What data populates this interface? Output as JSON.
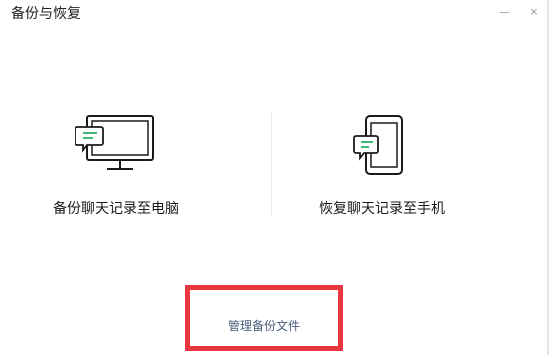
{
  "window": {
    "title": "备份与恢复",
    "minimize_icon": "minimize-icon",
    "close_label": "×"
  },
  "options": {
    "backup": {
      "label": "备份聊天记录至电脑",
      "icon": "monitor-chat-icon"
    },
    "restore": {
      "label": "恢复聊天记录至手机",
      "icon": "phone-chat-icon"
    }
  },
  "footer": {
    "manage_label": "管理备份文件",
    "highlight_color": "#e8383d"
  },
  "colors": {
    "accent_green": "#2aae67",
    "icon_stroke": "#1a1a1a"
  }
}
